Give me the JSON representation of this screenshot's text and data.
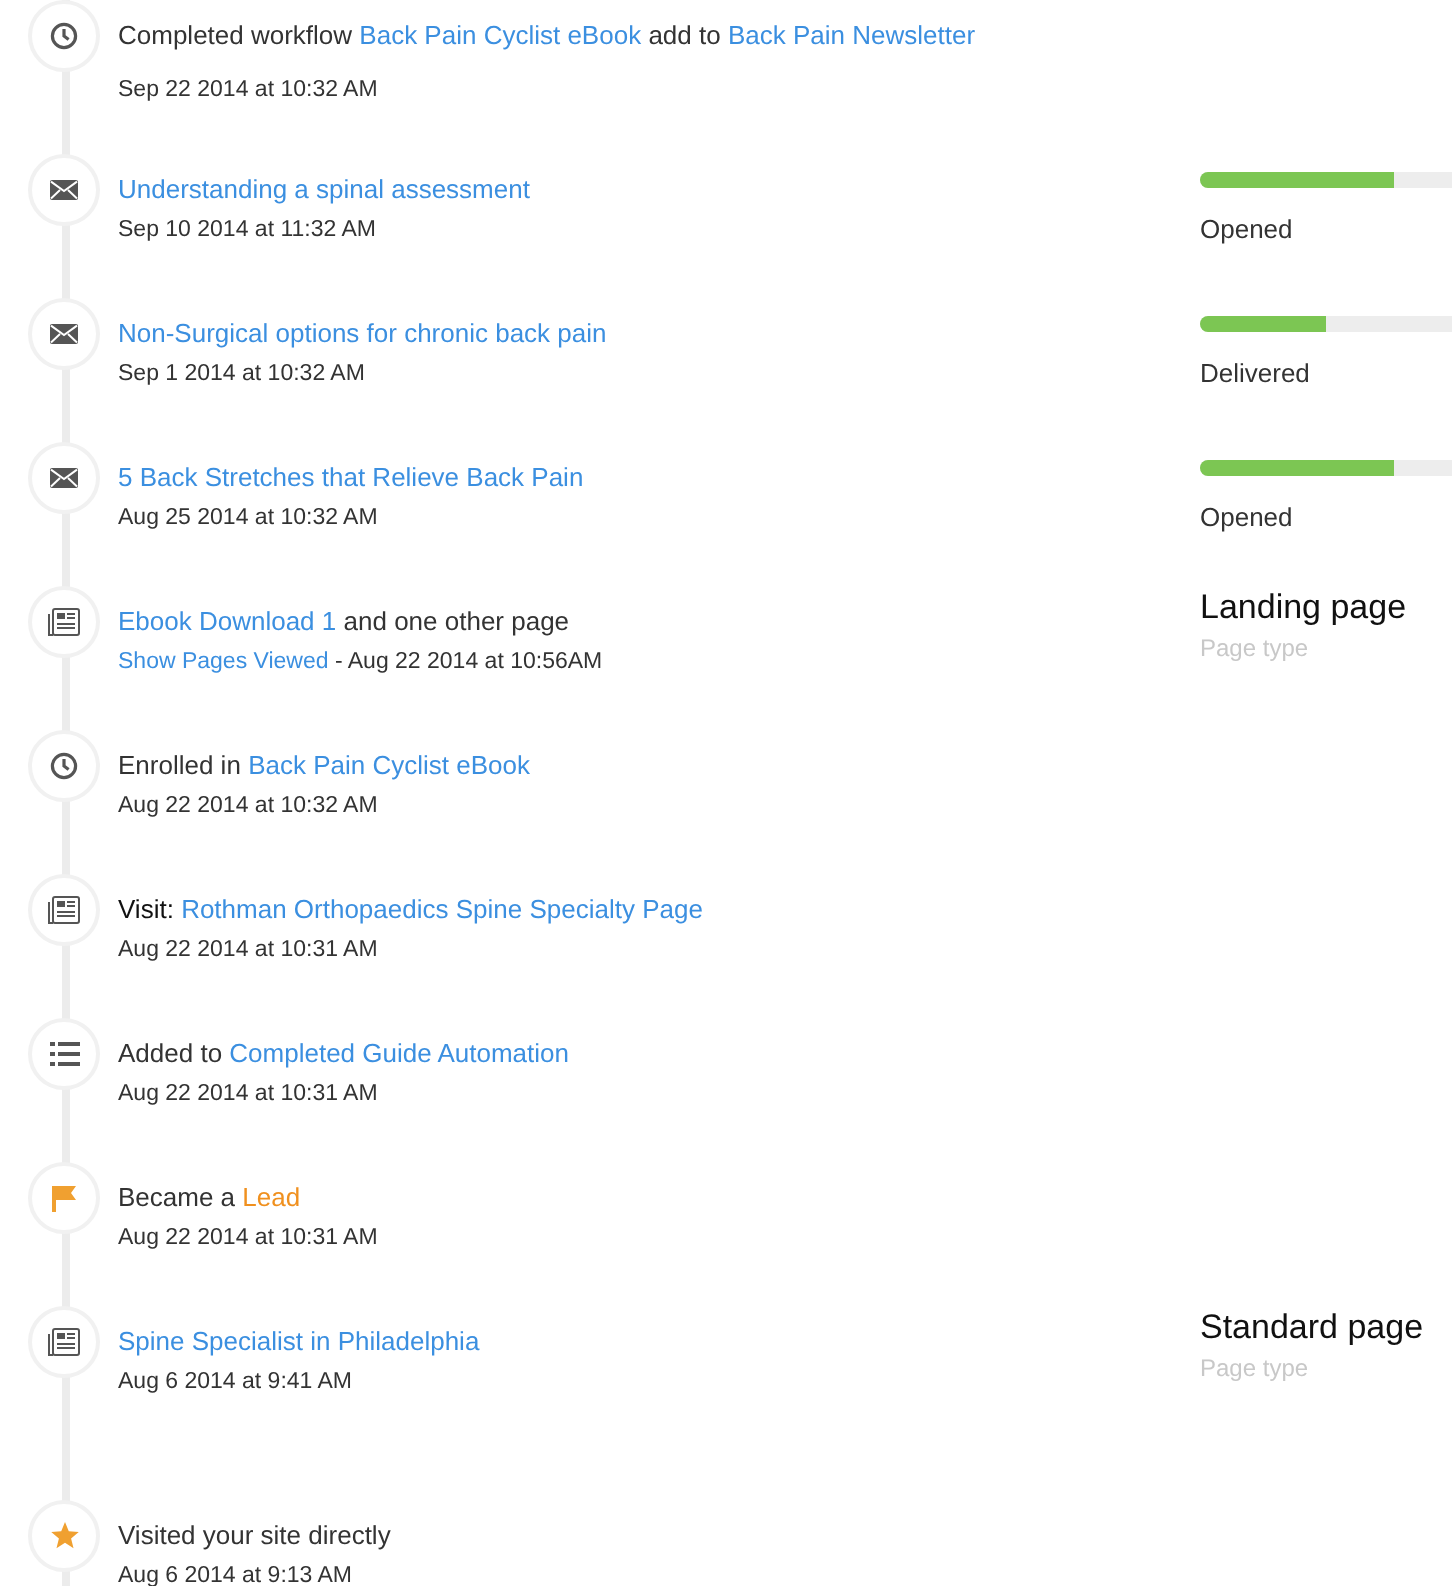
{
  "timeline": [
    {
      "kind": "clock",
      "title": [
        {
          "kind": "plain",
          "text": "Completed workflow"
        },
        {
          "kind": "link",
          "text": "Back Pain Cyclist eBook"
        },
        {
          "kind": "plain",
          "text": "add to"
        },
        {
          "kind": "link",
          "text": "Back Pain Newsletter"
        }
      ],
      "date": [
        {
          "kind": "plain",
          "text": "Sep 22 2014 at 10:32 AM"
        }
      ]
    },
    {
      "kind": "mail",
      "title": [
        {
          "kind": "link",
          "text": "Understanding a spinal assessment"
        }
      ],
      "date": [
        {
          "kind": "plain",
          "text": "Sep 10 2014 at 11:32 AM"
        }
      ],
      "side": {
        "kind": "progress",
        "level": 0.77,
        "status": "Opened"
      }
    },
    {
      "kind": "mail",
      "title": [
        {
          "kind": "link",
          "text": "Non-Surgical options for chronic back pain"
        }
      ],
      "date": [
        {
          "kind": "plain",
          "text": "Sep 1 2014 at 10:32 AM"
        }
      ],
      "side": {
        "kind": "progress",
        "level": 0.5,
        "status": "Delivered"
      }
    },
    {
      "kind": "mail",
      "title": [
        {
          "kind": "link",
          "text": "5 Back Stretches that Relieve Back Pain"
        }
      ],
      "date": [
        {
          "kind": "plain",
          "text": "Aug 25 2014 at 10:32 AM"
        }
      ],
      "side": {
        "kind": "progress",
        "level": 0.77,
        "status": "Opened"
      }
    },
    {
      "kind": "page",
      "title": [
        {
          "kind": "link",
          "text": "Ebook Download 1"
        },
        {
          "kind": "plain",
          "text": "and one other page"
        }
      ],
      "date": [
        {
          "kind": "link",
          "text": "Show Pages Viewed"
        },
        {
          "kind": "plain",
          "text": "- Aug 22 2014 at 10:56AM"
        }
      ],
      "side": {
        "kind": "page_type",
        "title": "Landing page",
        "caption": "Page type"
      }
    },
    {
      "kind": "clock",
      "title": [
        {
          "kind": "plain",
          "text": "Enrolled in"
        },
        {
          "kind": "link",
          "text": "Back Pain Cyclist eBook"
        }
      ],
      "date": [
        {
          "kind": "plain",
          "text": "Aug 22 2014 at 10:32 AM"
        }
      ]
    },
    {
      "kind": "page",
      "title": [
        {
          "kind": "dark",
          "text": "Visit:"
        },
        {
          "kind": "link",
          "text": "Rothman Orthopaedics Spine Specialty Page"
        }
      ],
      "date": [
        {
          "kind": "plain",
          "text": "Aug 22 2014 at 10:31 AM"
        }
      ]
    },
    {
      "kind": "list",
      "title": [
        {
          "kind": "plain",
          "text": "Added to"
        },
        {
          "kind": "link",
          "text": "Completed Guide Automation"
        }
      ],
      "date": [
        {
          "kind": "plain",
          "text": "Aug 22 2014 at 10:31 AM"
        }
      ]
    },
    {
      "kind": "flag",
      "title": [
        {
          "kind": "plain",
          "text": "Became a"
        },
        {
          "kind": "lead",
          "text": "Lead"
        }
      ],
      "date": [
        {
          "kind": "plain",
          "text": "Aug 22 2014 at 10:31 AM"
        }
      ]
    },
    {
      "kind": "page",
      "title": [
        {
          "kind": "link",
          "text": "Spine Specialist in Philadelphia"
        }
      ],
      "date": [
        {
          "kind": "plain",
          "text": "Aug 6 2014 at 9:41 AM"
        }
      ],
      "side": {
        "kind": "page_type",
        "title": "Standard page",
        "caption": "Page type"
      }
    },
    {
      "kind": "star",
      "title": [
        {
          "kind": "plain",
          "text": "Visited your site directly"
        }
      ],
      "date": [
        {
          "kind": "plain",
          "text": "Aug 6 2014 at 9:13 AM"
        }
      ]
    }
  ]
}
